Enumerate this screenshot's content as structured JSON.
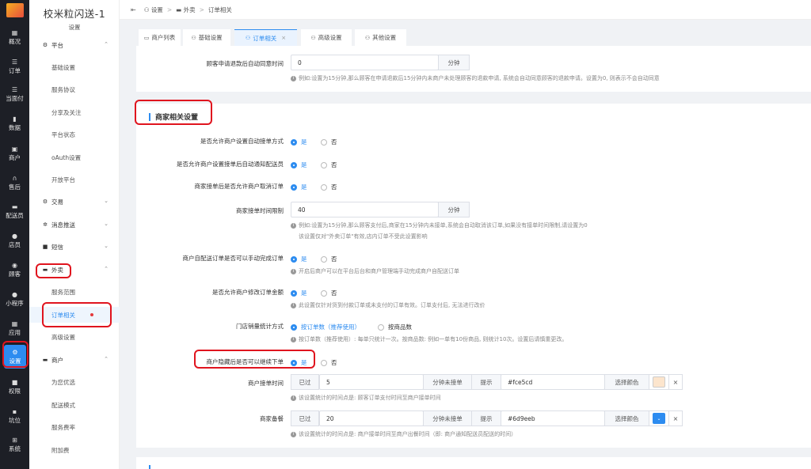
{
  "nav_rail": {
    "items": [
      {
        "label": "概况",
        "icon": "dashboard-icon"
      },
      {
        "label": "订单",
        "icon": "list-icon"
      },
      {
        "label": "当面付",
        "icon": "pay-icon"
      },
      {
        "label": "数据",
        "icon": "chart-icon"
      },
      {
        "label": "商户",
        "icon": "store-icon"
      },
      {
        "label": "售后",
        "icon": "headset-icon"
      },
      {
        "label": "配送员",
        "icon": "truck-icon"
      },
      {
        "label": "店员",
        "icon": "user-icon"
      },
      {
        "label": "顾客",
        "icon": "customer-icon"
      },
      {
        "label": "小程序",
        "icon": "chat-icon"
      },
      {
        "label": "应用",
        "icon": "apps-icon"
      },
      {
        "label": "设置",
        "icon": "settings-icon"
      },
      {
        "label": "权限",
        "icon": "lock-icon"
      },
      {
        "label": "坑位",
        "icon": "slot-icon"
      },
      {
        "label": "系统",
        "icon": "windows-icon"
      }
    ]
  },
  "sidebar": {
    "title": "校米粒闪送-1",
    "subtitle": "设置",
    "platform": {
      "label": "平台",
      "items": [
        "基础设置",
        "服务协议",
        "分享及关注",
        "平台状态",
        "oAuth设置",
        "开放平台"
      ]
    },
    "collapsed": [
      {
        "label": "交易"
      },
      {
        "label": "消息推送"
      },
      {
        "label": "短信"
      }
    ],
    "waimai": {
      "label": "外卖",
      "items": [
        "服务范围",
        "订单相关",
        "高级设置"
      ]
    },
    "merchant": {
      "label": "商户",
      "items": [
        "为您优选",
        "配送模式",
        "服务费率",
        "附加费"
      ]
    }
  },
  "breadcrumb": {
    "items": [
      "设置",
      "外卖",
      "订单相关"
    ]
  },
  "tabs": [
    {
      "label": "商户列表"
    },
    {
      "label": "基础设置"
    },
    {
      "label": "订单相关"
    },
    {
      "label": "高级设置"
    },
    {
      "label": "其他设置"
    }
  ],
  "refund": {
    "label": "顾客申请退款后自动同意时间",
    "value": "0",
    "unit": "分钟",
    "hint": "例如:设置为15分钟,那么顾客在申请退款后15分钟内未商户未处理顾客的退款申请, 系统会自动同意顾客的退款申请。设置为0, 则表示不会自动同意"
  },
  "merchant_section": {
    "title": "商家相关设置",
    "yes": "是",
    "no": "否",
    "rows": [
      {
        "label": "是否允许商户设置自动接单方式"
      },
      {
        "label": "是否允许商户设置接单后自动通知配送员"
      },
      {
        "label": "商家接单后是否允许商户取消订单"
      }
    ],
    "accept_limit": {
      "label": "商家接单时间限制",
      "value": "40",
      "unit": "分钟",
      "hint1": "例如:设置为15分钟,那么顾客支付后,商家在15分钟内未接单,系统会自动取消该订单,如果没有接单时间限制,请设置为0",
      "hint2": "该设置仅对\"外卖订单\"有效,店内订单不受此设置影响"
    },
    "self_delivery": {
      "label": "商户自配送订单是否可以手动完成订单",
      "hint": "开启后商户可以在平台后台和商户管理端手动完成商户自配送订单"
    },
    "modify_amount": {
      "label": "是否允许商户修改订单金额",
      "hint": "此设置仅针对货到付款订单或未支付的订单有效。订单支付后, 无法进行改价"
    },
    "sales_count": {
      "label": "门店销量统计方式",
      "opt1": "按订单数（推荐使用）",
      "opt2": "按商品数",
      "hint": "按订单数（推荐使用）: 每单只统计一次。按商品数: 例如一单有10份商品, 则统计10次。设置后请慎重更改。"
    },
    "hidden_order": {
      "label": "商户隐藏后是否可以继续下单"
    },
    "accept_time": {
      "label": "商户接单时间",
      "prefix": "已过",
      "value": "5",
      "unit": "分钟未接单",
      "tip_label": "提示",
      "color_value": "#fce5cd",
      "pick_label": "选择颜色",
      "swatch_color": "#fce5cd",
      "hint": "该设置统计的时间点是: 顾客订单支付时间至商户接单时间"
    },
    "prep_meal": {
      "label": "商家备餐",
      "prefix": "已过",
      "value": "20",
      "unit": "分钟未接单",
      "tip_label": "提示",
      "color_value": "#6d9eeb",
      "pick_label": "选择颜色",
      "swatch_color": "#6d9eeb",
      "hint": "该设置统计的时间点是: 商户接单时间至商户出餐时间（即: 商户通知配送员配送的时间）"
    }
  },
  "colors": {
    "accent": "#2d8cf0",
    "annotation": "#e0141e",
    "rail_bg": "#1d1f26"
  }
}
